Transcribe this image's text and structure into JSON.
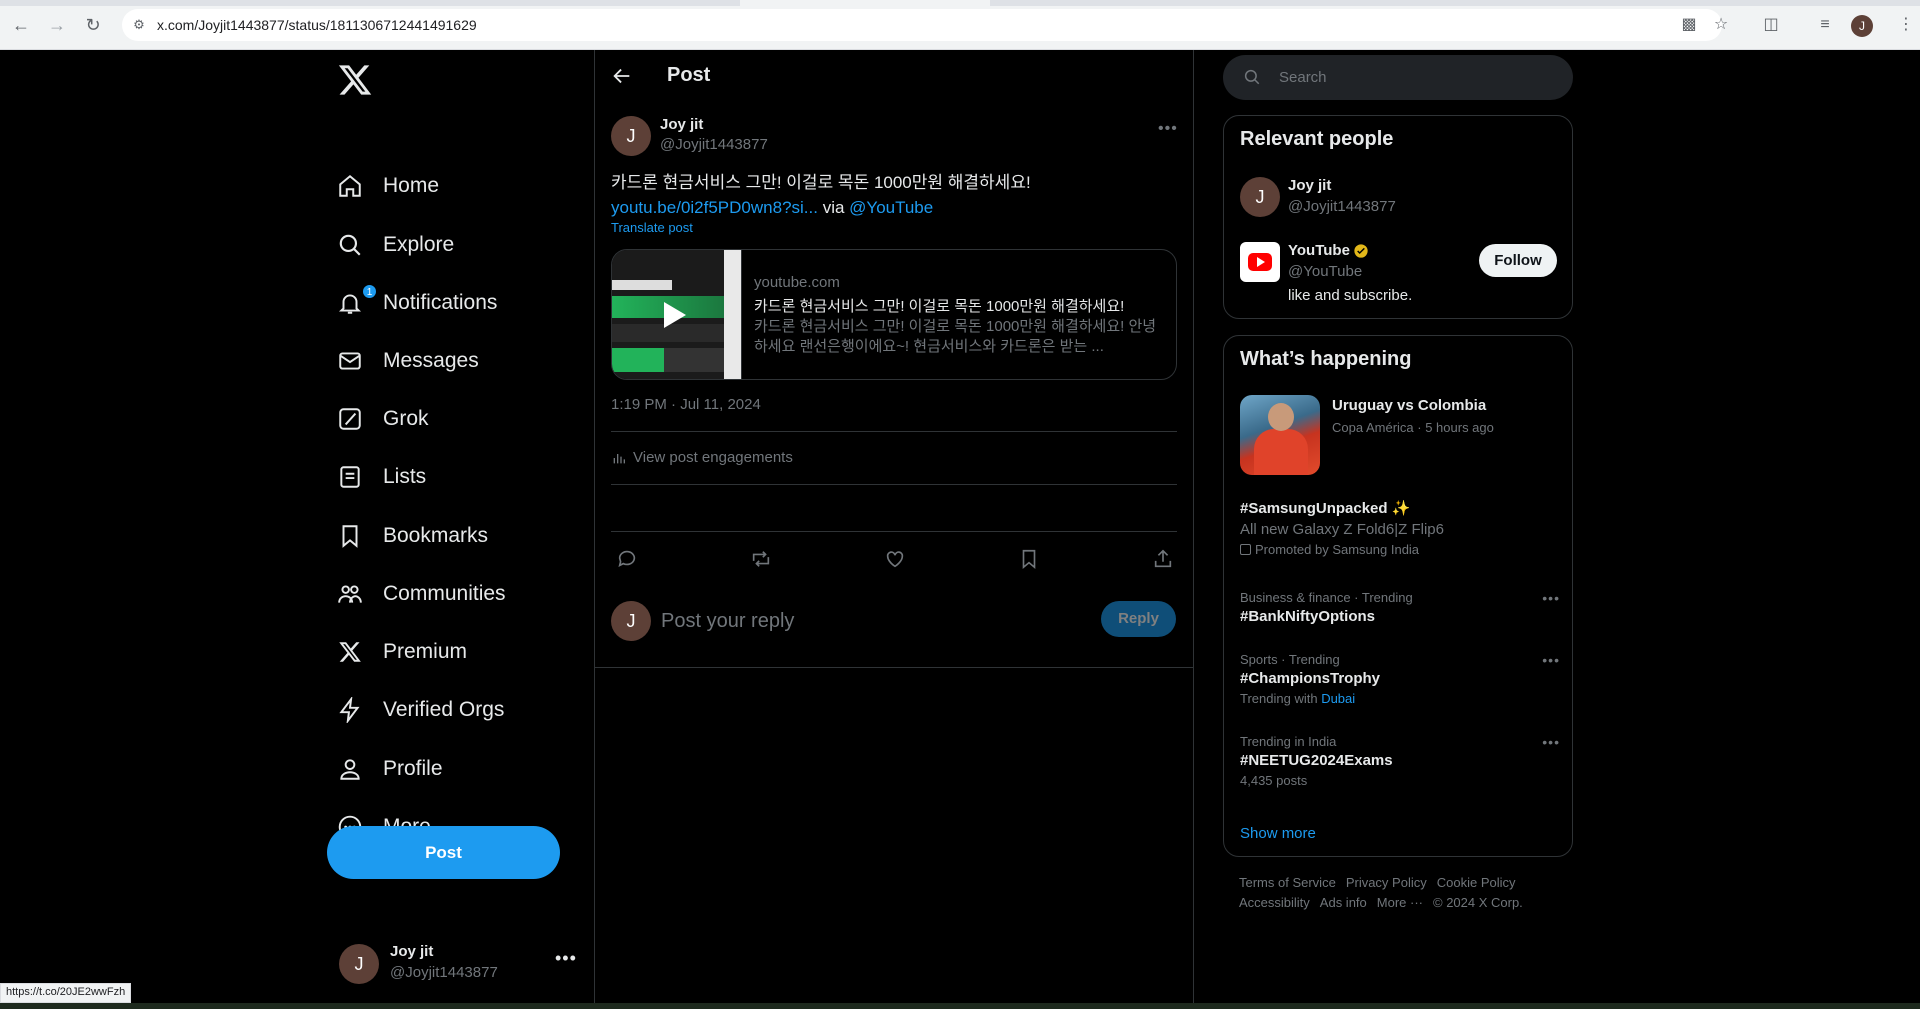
{
  "browser": {
    "url": "x.com/Joyjit1443877/status/1811306712441491629",
    "profile_initial": "J",
    "status_url": "https://t.co/20JE2wwFzh"
  },
  "sidebar": {
    "items": [
      {
        "label": "Home",
        "icon": "home-icon"
      },
      {
        "label": "Explore",
        "icon": "search-icon"
      },
      {
        "label": "Notifications",
        "icon": "bell-icon"
      },
      {
        "label": "Messages",
        "icon": "envelope-icon"
      },
      {
        "label": "Grok",
        "icon": "grok-icon"
      },
      {
        "label": "Lists",
        "icon": "list-icon"
      },
      {
        "label": "Bookmarks",
        "icon": "bookmark-icon"
      },
      {
        "label": "Communities",
        "icon": "communities-icon"
      },
      {
        "label": "Premium",
        "icon": "x-icon"
      },
      {
        "label": "Verified Orgs",
        "icon": "lightning-icon"
      },
      {
        "label": "Profile",
        "icon": "person-icon"
      },
      {
        "label": "More",
        "icon": "more-circle-icon"
      }
    ],
    "notifications_badge": "1",
    "post_button": "Post",
    "account": {
      "initial": "J",
      "name": "Joy jit",
      "handle": "@Joyjit1443877"
    }
  },
  "main": {
    "header_title": "Post",
    "tweet": {
      "avatar_initial": "J",
      "name": "Joy jit",
      "handle": "@Joyjit1443877",
      "text": "카드론 현금서비스 그만! 이걸로 목돈 1000만원 해결하세요!",
      "link": "youtu.be/0i2f5PD0wn8?si...",
      "via": " via ",
      "mention": "@YouTube",
      "translate": "Translate post",
      "card": {
        "domain": "youtube.com",
        "title": "카드론 현금서비스 그만! 이걸로 목돈 1000만원 해결하세요!",
        "description": "카드론 현금서비스 그만! 이걸로 목돈 1000만원 해결하세요! 안녕하세요 랜선은행이에요~! 현금서비스와 카드론은 받는 ..."
      },
      "timestamp": "1:19 PM · Jul 11, 2024",
      "view_engagements": "View post engagements"
    },
    "reply": {
      "avatar_initial": "J",
      "placeholder": "Post your reply",
      "button": "Reply"
    }
  },
  "right": {
    "search_placeholder": "Search",
    "relevant_people": {
      "title": "Relevant people",
      "people": [
        {
          "initial": "J",
          "name": "Joy jit",
          "handle": "@Joyjit1443877"
        },
        {
          "name": "YouTube",
          "handle": "@YouTube",
          "bio": "like and subscribe.",
          "follow": "Follow"
        }
      ]
    },
    "whats_happening": {
      "title": "What’s happening",
      "news": {
        "title": "Uruguay vs Colombia",
        "meta": "Copa América · 5 hours ago"
      },
      "trends": [
        {
          "title": "#SamsungUnpacked",
          "sub": "All new Galaxy Z Fold6|Z Flip6",
          "promo": "Promoted by Samsung India"
        },
        {
          "meta": "Business & finance · Trending",
          "title": "#BankNiftyOptions"
        },
        {
          "meta": "Sports · Trending",
          "title": "#ChampionsTrophy",
          "sub_prefix": "Trending with",
          "sub_link": "Dubai"
        },
        {
          "meta": "Trending in India",
          "title": "#NEETUG2024Exams",
          "sub": "4,435 posts"
        }
      ],
      "show_more": "Show more"
    },
    "footer": [
      "Terms of Service",
      "Privacy Policy",
      "Cookie Policy",
      "Accessibility",
      "Ads info",
      "More ···",
      "© 2024 X Corp."
    ]
  },
  "colors": {
    "accent": "#1d9bf0",
    "background": "#000000",
    "border": "#2f3336",
    "muted": "#71767b"
  }
}
